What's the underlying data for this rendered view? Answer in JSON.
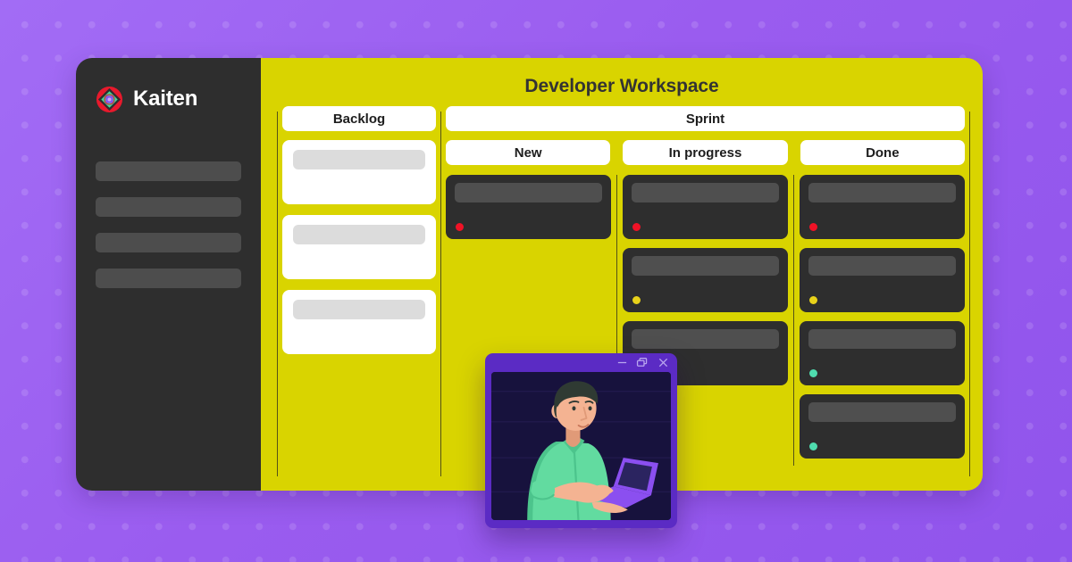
{
  "brand": {
    "name": "Kaiten",
    "logo_icon": "kaiten-logo-icon",
    "logo_colors": {
      "ring": "#e8192c",
      "diamond": "#3ddc9a",
      "core": "#8b4ff0"
    }
  },
  "theme": {
    "background_purple": "#9b5df0",
    "background_dot": "#b07ff5",
    "board_yellow": "#d9d400",
    "sidebar_dark": "#2e2e2e",
    "card_dark": "#2e2e2e",
    "card_bar_dark": "#4f4f4f",
    "card_light": "#ffffff",
    "card_bar_light": "#dcdcdc",
    "window_purple": "#5b2bc4",
    "window_canvas": "#17123d",
    "divider": "#555316"
  },
  "sidebar": {
    "nav_items": [
      {
        "label": ""
      },
      {
        "label": ""
      },
      {
        "label": ""
      },
      {
        "label": ""
      }
    ]
  },
  "board": {
    "title": "Developer Workspace",
    "backlog": {
      "header": "Backlog",
      "cards": [
        {
          "dot": null
        },
        {
          "dot": null
        },
        {
          "dot": null
        }
      ]
    },
    "sprint": {
      "header": "Sprint",
      "lanes": [
        {
          "header": "New",
          "cards": [
            {
              "dot": "#f01226"
            }
          ]
        },
        {
          "header": "In progress",
          "cards": [
            {
              "dot": "#f01226"
            },
            {
              "dot": "#e8d21a"
            },
            {
              "dot": null
            }
          ]
        },
        {
          "header": "Done",
          "cards": [
            {
              "dot": "#f01226"
            },
            {
              "dot": "#e8d21a"
            },
            {
              "dot": "#4fdcae"
            },
            {
              "dot": "#4fdcae"
            }
          ]
        }
      ]
    }
  },
  "illustration_window": {
    "controls": [
      {
        "icon": "minimize-icon",
        "glyph": "minimize"
      },
      {
        "icon": "restore-icon",
        "glyph": "restore"
      },
      {
        "icon": "close-icon",
        "glyph": "close"
      }
    ],
    "scene": {
      "description": "developer-with-laptop-illustration",
      "skin": "#f4b392",
      "hair": "#2f3a33",
      "shirt": "#62dba0",
      "shirt_shadow": "#4cc48c",
      "laptop": "#8b4ff0",
      "laptop_screen": "#2b2460"
    }
  }
}
